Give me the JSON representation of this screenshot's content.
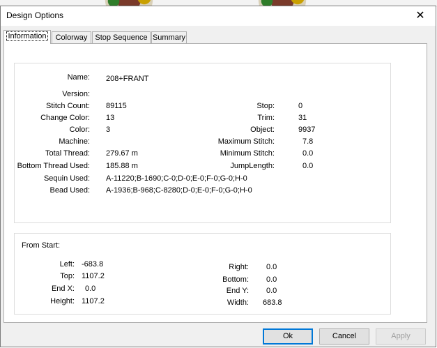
{
  "window": {
    "title": "Design Options"
  },
  "tabs": [
    {
      "label": "Information"
    },
    {
      "label": "Colorway"
    },
    {
      "label": "Stop Sequence"
    },
    {
      "label": "Summary"
    }
  ],
  "info": {
    "name_label": "Name:",
    "name": "208+FRANT",
    "version_label": "Version:",
    "version": "",
    "stitch_count_label": "Stitch Count:",
    "stitch_count": "89115",
    "change_color_label": "Change Color:",
    "change_color": "13",
    "color_label": "Color:",
    "color": "3",
    "machine_label": "Machine:",
    "machine": "",
    "total_thread_label": "Total Thread:",
    "total_thread": "279.67 m",
    "bottom_thread_label": "Bottom Thread Used:",
    "bottom_thread": "185.88 m",
    "sequin_label": "Sequin Used:",
    "sequin": "A-11220;B-1690;C-0;D-0;E-0;F-0;G-0;H-0",
    "bead_label": "Bead Used:",
    "bead": "A-1936;B-968;C-8280;D-0;E-0;F-0;G-0;H-0",
    "stop_label": "Stop:",
    "stop": "0",
    "trim_label": "Trim:",
    "trim": "31",
    "object_label": "Object:",
    "object": "9937",
    "max_stitch_label": "Maximum Stitch:",
    "max_stitch": "7.8",
    "min_stitch_label": "Minimum Stitch:",
    "min_stitch": "0.0",
    "jump_length_label": "JumpLength:",
    "jump_length": "0.0"
  },
  "from_start": {
    "heading": "From Start:",
    "left_label": "Left:",
    "left": "-683.8",
    "top_label": "Top:",
    "top": "1107.2",
    "endx_label": "End X:",
    "endx": "0.0",
    "height_label": "Height:",
    "height": "1107.2",
    "right_label": "Right:",
    "right": "0.0",
    "bottom_label": "Bottom:",
    "bottom": "0.0",
    "endy_label": "End Y:",
    "endy": "0.0",
    "width_label": "Width:",
    "width": "683.8"
  },
  "buttons": {
    "ok": "Ok",
    "cancel": "Cancel",
    "apply": "Apply"
  },
  "colors": {
    "accent": "#0078d7"
  }
}
